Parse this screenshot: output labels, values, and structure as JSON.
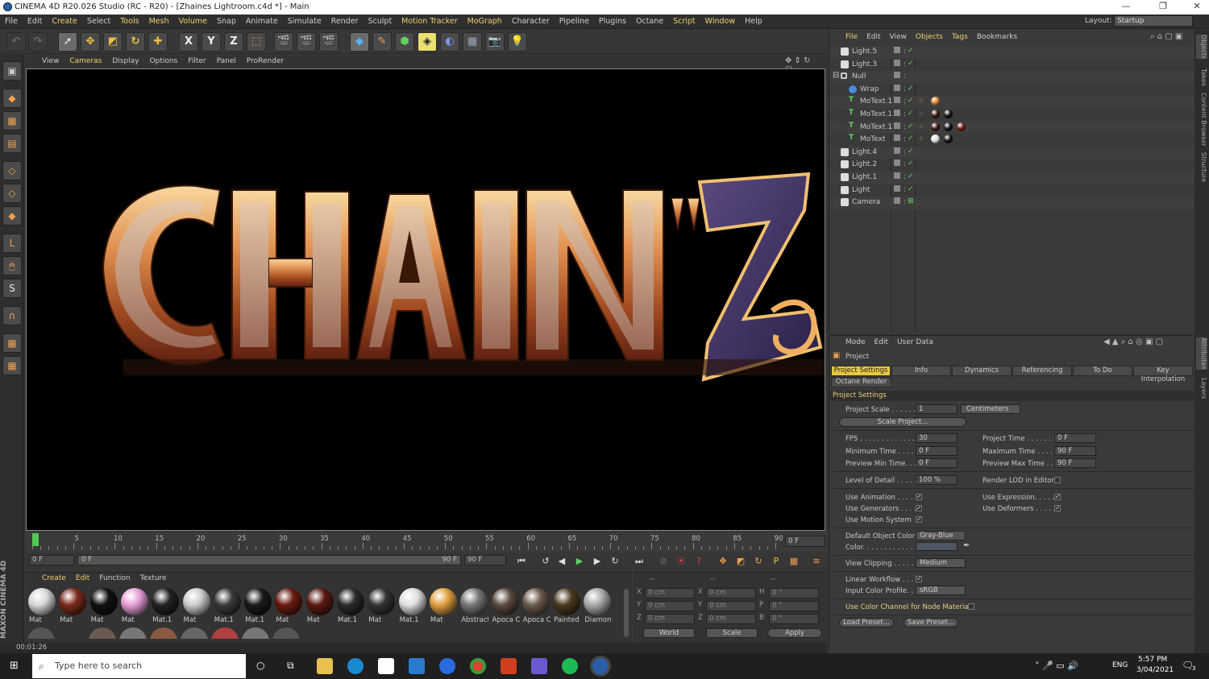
{
  "window": {
    "title": "CINEMA 4D R20.026 Studio (RC - R20) - [Zhaines Lightroom.c4d *] - Main"
  },
  "menu": [
    "File",
    "Edit",
    "Create",
    "Select",
    "Tools",
    "Mesh",
    "Volume",
    "Snap",
    "Animate",
    "Simulate",
    "Render",
    "Sculpt",
    "Motion Tracker",
    "MoGraph",
    "Character",
    "Pipeline",
    "Plugins",
    "Octane",
    "Script",
    "Window",
    "Help"
  ],
  "layout": {
    "label": "Layout:",
    "value": "Startup"
  },
  "viewport_menu": [
    "View",
    "Cameras",
    "Display",
    "Options",
    "Filter",
    "Panel",
    "ProRender"
  ],
  "timeline": {
    "ticks": [
      "0",
      "5",
      "10",
      "15",
      "20",
      "25",
      "30",
      "35",
      "40",
      "45",
      "50",
      "55",
      "60",
      "65",
      "70",
      "75",
      "80",
      "85",
      "90"
    ],
    "current": "0 F"
  },
  "transport": {
    "start": "0 F",
    "range_start": "0 F",
    "range_end": "90 F",
    "end": "90 F"
  },
  "materials_menu": [
    "Create",
    "Edit",
    "Function",
    "Texture"
  ],
  "materials": [
    {
      "name": "Mat",
      "color": "#d8d8d8"
    },
    {
      "name": "Mat",
      "color": "#7a2a1a"
    },
    {
      "name": "Mat",
      "color": "#111111"
    },
    {
      "name": "Mat",
      "color": "#e8a0d8"
    },
    {
      "name": "Mat.1",
      "color": "#222222"
    },
    {
      "name": "Mat",
      "color": "#cccccc"
    },
    {
      "name": "Mat.1",
      "color": "#3a3a3a"
    },
    {
      "name": "Mat.1",
      "color": "#1a1a1a"
    },
    {
      "name": "Mat",
      "color": "#6a1a10"
    },
    {
      "name": "Mat",
      "color": "#5a1a12"
    },
    {
      "name": "Mat.1",
      "color": "#2a2a2a"
    },
    {
      "name": "Mat",
      "color": "#333333"
    },
    {
      "name": "Mat.1",
      "color": "#e0e0e0"
    },
    {
      "name": "Mat",
      "color": "#e0a040"
    },
    {
      "name": "Abstract",
      "color": "#777777"
    },
    {
      "name": "Apoca C",
      "color": "#5a4a40"
    },
    {
      "name": "Apoca C",
      "color": "#6a5a4a"
    },
    {
      "name": "Painted",
      "color": "#4a3a20"
    },
    {
      "name": "Diamon",
      "color": "#aaaaaa"
    }
  ],
  "coords": {
    "header": [
      "--",
      "--",
      "--"
    ],
    "rows": [
      [
        "X",
        "0 cm",
        "X",
        "0 cm",
        "H",
        "0 °"
      ],
      [
        "Y",
        "0 cm",
        "Y",
        "0 cm",
        "P",
        "0 °"
      ],
      [
        "Z",
        "0 cm",
        "Z",
        "0 cm",
        "B",
        "0 °"
      ]
    ],
    "world": "World",
    "scale": "Scale",
    "apply": "Apply"
  },
  "status": {
    "time": "00:01:26"
  },
  "maxon": "MAXON CINEMA 4D",
  "objects_menu": [
    "File",
    "Edit",
    "View",
    "Objects",
    "Tags",
    "Bookmarks"
  ],
  "objects": [
    {
      "name": "Light.5",
      "indent": 0,
      "icon": "light"
    },
    {
      "name": "Light.3",
      "indent": 0,
      "icon": "light"
    },
    {
      "name": "Null",
      "indent": 0,
      "icon": "null"
    },
    {
      "name": "Wrap",
      "indent": 1,
      "icon": "wrap"
    },
    {
      "name": "MoText.1",
      "indent": 1,
      "icon": "text"
    },
    {
      "name": "MoText.1",
      "indent": 1,
      "icon": "text"
    },
    {
      "name": "MoText.1",
      "indent": 1,
      "icon": "text"
    },
    {
      "name": "MoText",
      "indent": 1,
      "icon": "text"
    },
    {
      "name": "Light.4",
      "indent": 0,
      "icon": "light"
    },
    {
      "name": "Light.2",
      "indent": 0,
      "icon": "light"
    },
    {
      "name": "Light.1",
      "indent": 0,
      "icon": "light"
    },
    {
      "name": "Light",
      "indent": 0,
      "icon": "light"
    },
    {
      "name": "Camera",
      "indent": 0,
      "icon": "camera"
    }
  ],
  "attr_menu": [
    "Mode",
    "Edit",
    "User Data"
  ],
  "attr_title": "Project",
  "attr_tabs": [
    "Project Settings",
    "Info",
    "Dynamics",
    "Referencing",
    "To Do",
    "Key Interpolation"
  ],
  "attr_tab2": "Octane Render",
  "section": "Project Settings",
  "fields": {
    "project_scale": {
      "label": "Project Scale . . . . . . . .",
      "value": "1",
      "unit": "Centimeters"
    },
    "scale_project": "Scale Project...",
    "fps": {
      "label": "FPS . . . . . . . . . . . . . . . .",
      "value": "30"
    },
    "project_time": {
      "label": "Project Time . . . . . . . .",
      "value": "0 F"
    },
    "min_time": {
      "label": "Minimum Time . . . . .",
      "value": "0 F"
    },
    "max_time": {
      "label": "Maximum Time . . . . .",
      "value": "90 F"
    },
    "prev_min": {
      "label": "Preview Min Time. . .",
      "value": "0 F"
    },
    "prev_max": {
      "label": "Preview Max Time . . .",
      "value": "90 F"
    },
    "lod": {
      "label": "Level of Detail . . . . .",
      "value": "100 %"
    },
    "render_lod": "Render LOD in Editor",
    "use_anim": "Use Animation . . . . .",
    "use_expr": "Use Expression. . . . . .",
    "use_gen": "Use Generators . . . .",
    "use_def": "Use Deformers . . . . .",
    "use_motion": "Use Motion System",
    "def_color": {
      "label": "Default Object Color",
      "value": "Gray-Blue"
    },
    "color": "Color. . . . . . . . . . . . .",
    "clipping": {
      "label": "View Clipping . . . . . .",
      "value": "Medium"
    },
    "linear": "Linear Workflow . . . .",
    "icc": {
      "label": "Input Color Profile. . .",
      "value": "sRGB"
    },
    "node_mat": "Use Color Channel for Node Material",
    "load": "Load Preset...",
    "save": "Save Preset..."
  },
  "side_tabs": [
    "Objects",
    "Takes",
    "Content Browser",
    "Structure"
  ],
  "side_tabs2": [
    "Attributes",
    "Layers"
  ],
  "taskbar": {
    "search": "Type here to search",
    "lang": "ENG",
    "time": "5:57 PM",
    "date": "3/04/2021",
    "notif": "3"
  },
  "colors": {
    "accent": "#e8c840",
    "check": "#5fd35f"
  }
}
